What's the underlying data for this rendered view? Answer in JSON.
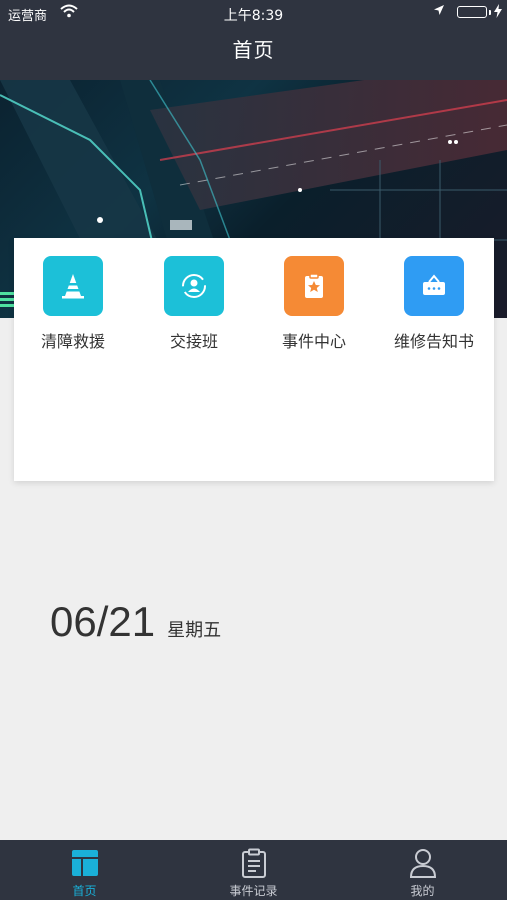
{
  "status_bar": {
    "carrier": "运营商",
    "time": "上午8:39",
    "battery_color": "#4cd964"
  },
  "nav": {
    "title": "首页"
  },
  "menu": [
    {
      "label": "清障救援",
      "icon": "traffic-cone-icon",
      "color": "#1cc0d8"
    },
    {
      "label": "交接班",
      "icon": "shift-handover-icon",
      "color": "#1cc0d8"
    },
    {
      "label": "事件中心",
      "icon": "clipboard-star-icon",
      "color": "#f58a35"
    },
    {
      "label": "维修告知书",
      "icon": "notice-board-icon",
      "color": "#2f9cf3"
    }
  ],
  "date": {
    "month_day": "06/21",
    "weekday": "星期五"
  },
  "tabs": [
    {
      "label": "首页",
      "icon": "home-layout-icon",
      "active": true
    },
    {
      "label": "事件记录",
      "icon": "clipboard-list-icon",
      "active": false
    },
    {
      "label": "我的",
      "icon": "user-icon",
      "active": false
    }
  ],
  "colors": {
    "bar": "#2f3440",
    "accent": "#1ab0d8",
    "background": "#efefef"
  }
}
